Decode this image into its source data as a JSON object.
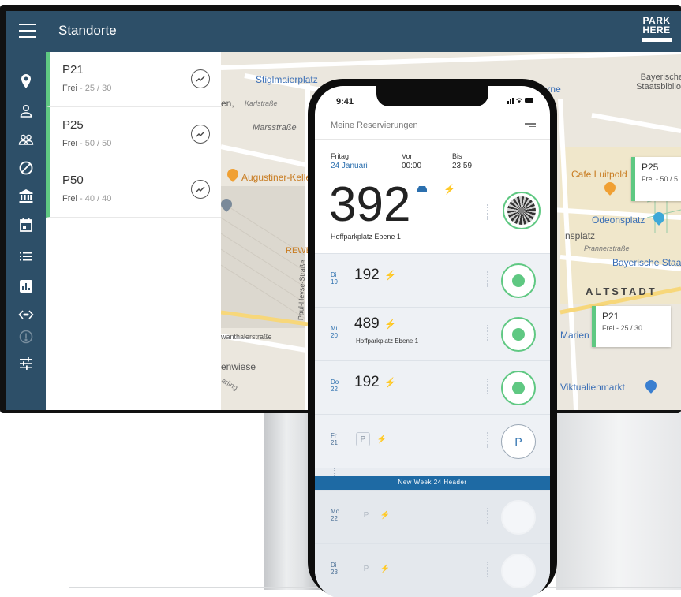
{
  "desktop": {
    "title": "Standorte",
    "brand": {
      "line1": "PARK",
      "line2": "HERE"
    },
    "rail_icons": [
      "location-icon",
      "user-icon",
      "users-icon",
      "block-icon",
      "bank-icon",
      "calendar-icon",
      "list-icon",
      "chart-icon",
      "code-icon",
      "alert-icon",
      "sliders-icon"
    ],
    "locations": [
      {
        "name": "P21",
        "status": "Frei",
        "count": "- 25 / 30"
      },
      {
        "name": "P25",
        "status": "Frei",
        "count": "- 50 / 50"
      },
      {
        "name": "P50",
        "status": "Frei",
        "count": "- 40 / 40"
      }
    ],
    "map": {
      "labels": {
        "stiglmaierplatz": "Stiglmaierplatz",
        "pinakothek": "Pinakothek der Moderne",
        "bayerische_bib": "Bayerische Staatsbibliot",
        "karlstrasse": "Karlstraße",
        "marsstrasse": "Marsstraße",
        "augustiner": "Augustiner-Kelle",
        "cafe_luitpold": "Cafe Luitpold",
        "odeonsplatz": "Odeonsplatz",
        "prannerstrasse": "Prannerstraße",
        "bayerische_staats": "Bayerische Staa",
        "altstadt": "ALTSTADT",
        "rewe": "REWE T",
        "paul_heyse": "Paul-Heyse-Straße",
        "schwanthaler": "wanthalerstraße",
        "theresienwiese": "enwiese",
        "viktualienmarkt": "Viktualienmarkt",
        "marien": "Marien",
        "en": "en,",
        "ansplatz": "nsplatz",
        "arisstrasse": "ariing"
      },
      "cards": [
        {
          "name": "P25",
          "status": "Frei - 50 / 5"
        },
        {
          "name": "P21",
          "status": "Frei - 25 / 30"
        }
      ]
    }
  },
  "phone": {
    "time": "9:41",
    "header_title": "Meine Reservierungen",
    "hero": {
      "day_label": "Fritag",
      "day_value": "24 Januari",
      "from_label": "Von",
      "from_value": "00:00",
      "to_label": "Bis",
      "to_value": "23:59",
      "spot": "392",
      "location": "Hoffparkplatz  Ebene 1"
    },
    "rows": [
      {
        "dow": "Di",
        "day": "19",
        "spot": "192",
        "sub": ""
      },
      {
        "dow": "Mi",
        "day": "20",
        "spot": "489",
        "sub": "Hoffparkplatz  Ebene 1"
      },
      {
        "dow": "Do",
        "day": "22",
        "spot": "192",
        "sub": ""
      },
      {
        "dow": "Fr",
        "day": "21",
        "chip_p": "P",
        "chip_bolt": "⚡",
        "ring": "P"
      },
      {
        "dow": "Mo",
        "day": "22",
        "chip_p": "P",
        "chip_bolt": "⚡"
      },
      {
        "dow": "Di",
        "day": "23",
        "chip_p": "P",
        "chip_bolt": "⚡"
      }
    ],
    "week_header": "New Week 24 Header",
    "bolt": "⚡"
  },
  "colors": {
    "topbar": "#2d4f68",
    "accent_green": "#5fc882",
    "accent_blue": "#1e6aa4"
  }
}
